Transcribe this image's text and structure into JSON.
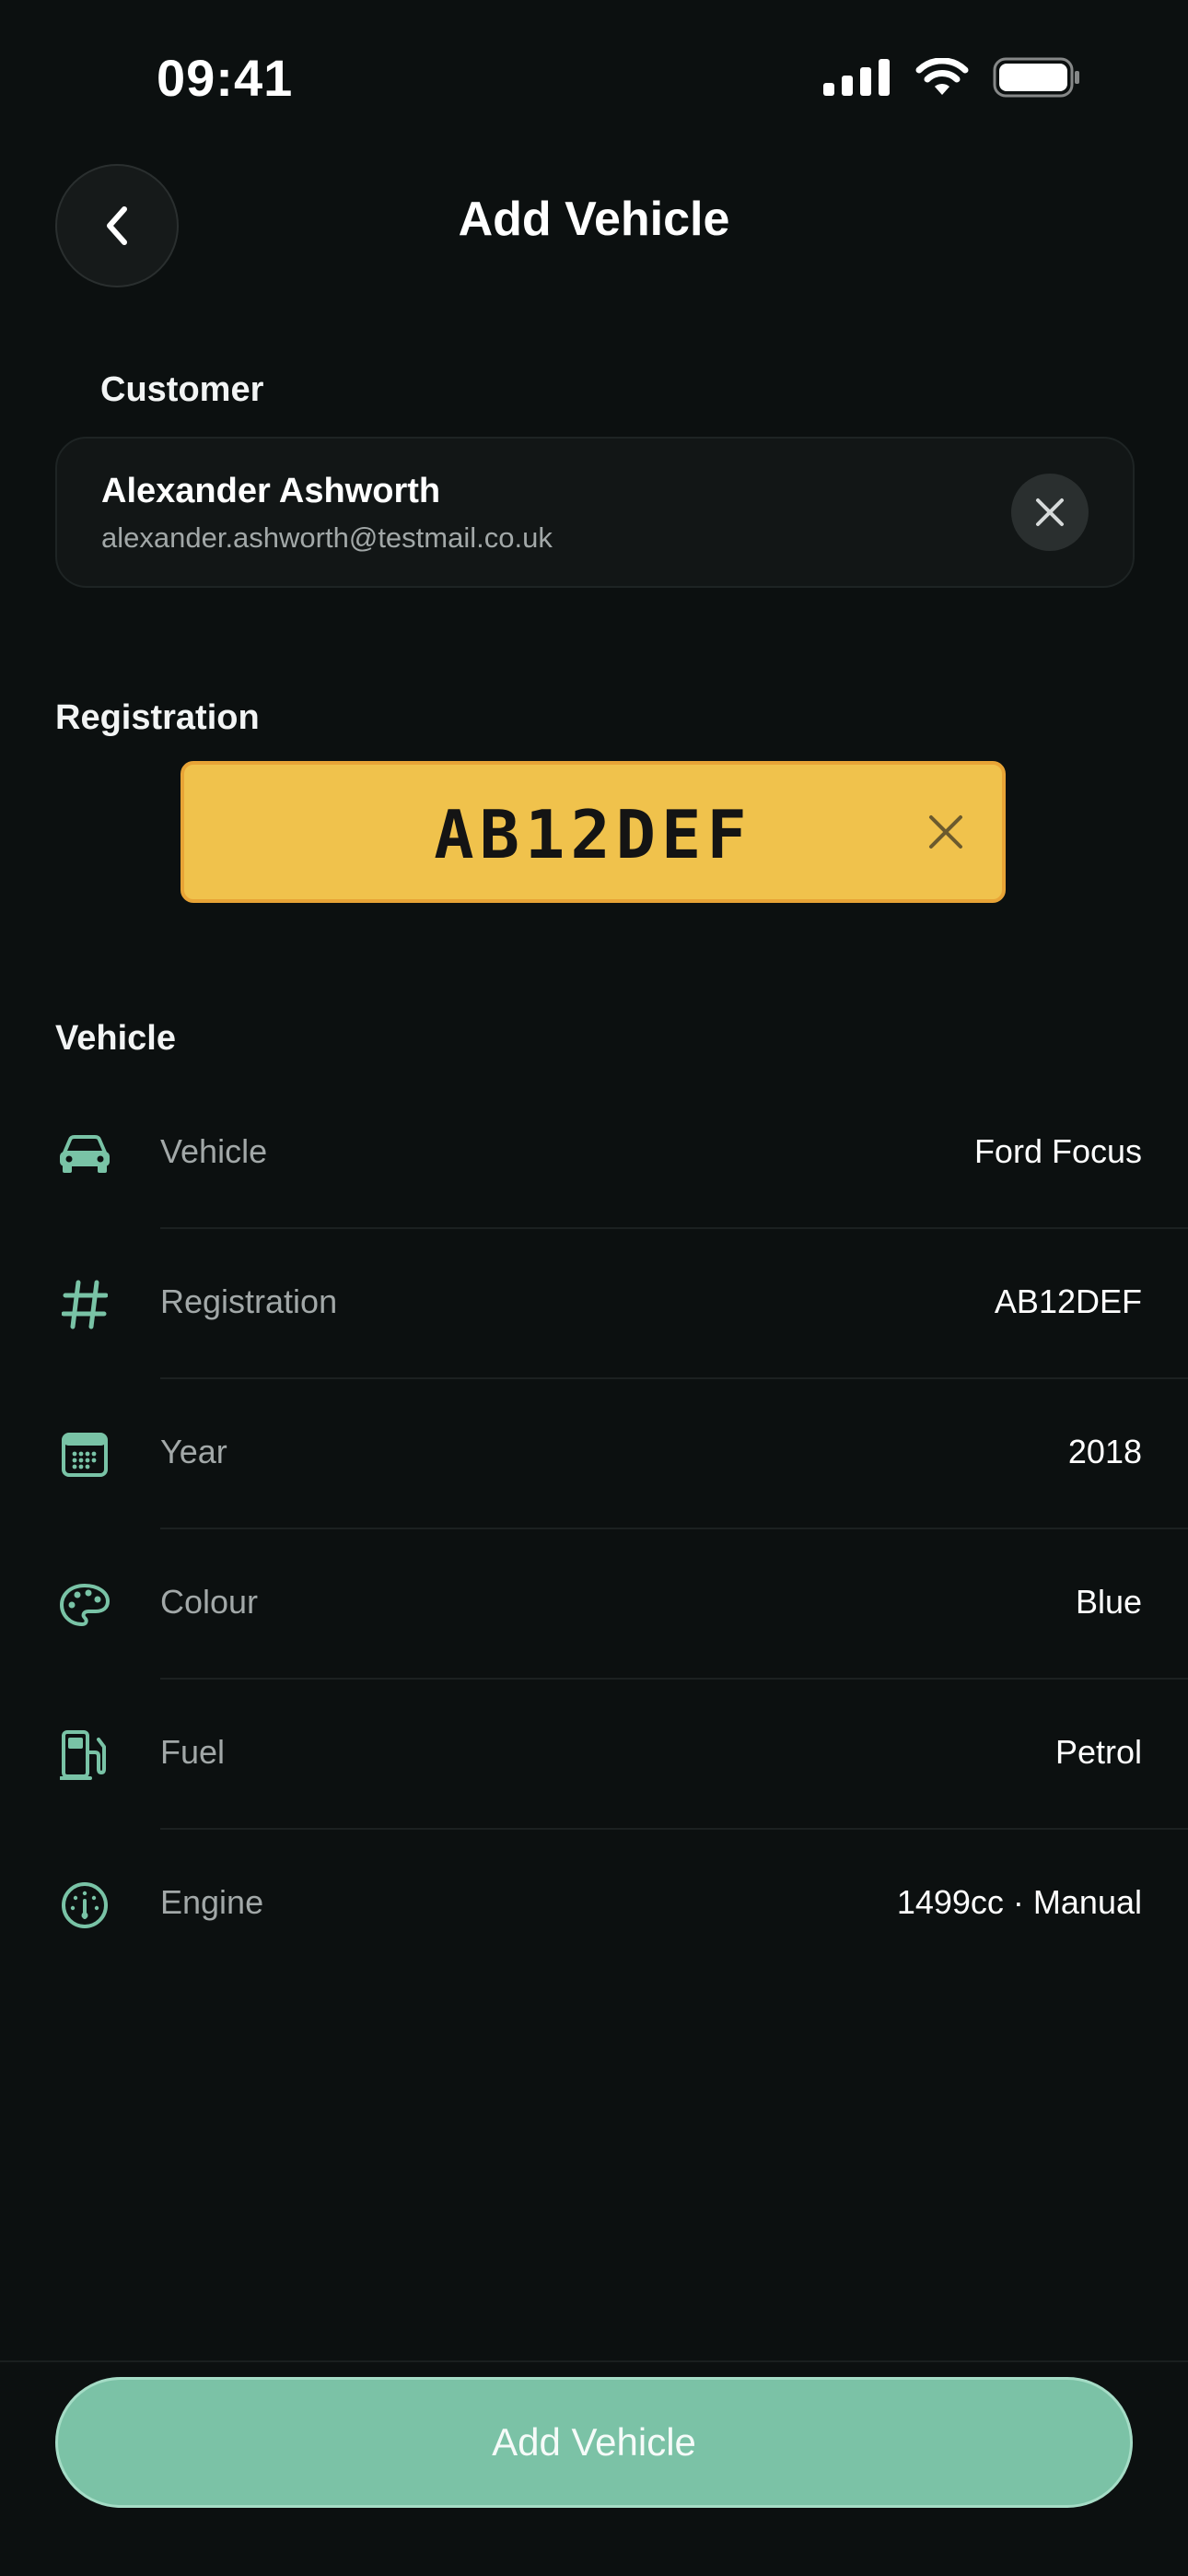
{
  "status_bar": {
    "time": "09:41"
  },
  "header": {
    "title": "Add Vehicle"
  },
  "customer": {
    "section_label": "Customer",
    "name": "Alexander Ashworth",
    "email": "alexander.ashworth@testmail.co.uk"
  },
  "registration": {
    "section_label": "Registration",
    "plate": "AB12DEF"
  },
  "vehicle": {
    "section_label": "Vehicle",
    "rows": [
      {
        "icon": "car-icon",
        "label": "Vehicle",
        "value": "Ford Focus"
      },
      {
        "icon": "hash-icon",
        "label": "Registration",
        "value": "AB12DEF"
      },
      {
        "icon": "calendar-icon",
        "label": "Year",
        "value": "2018"
      },
      {
        "icon": "palette-icon",
        "label": "Colour",
        "value": "Blue"
      },
      {
        "icon": "fuel-pump-icon",
        "label": "Fuel",
        "value": "Petrol"
      },
      {
        "icon": "gauge-icon",
        "label": "Engine",
        "value": "1499cc · Manual"
      }
    ]
  },
  "actions": {
    "add_label": "Add Vehicle"
  },
  "colors": {
    "accent": "#7bc2a6",
    "plate": "#f0c24c",
    "background": "#0c1010"
  }
}
